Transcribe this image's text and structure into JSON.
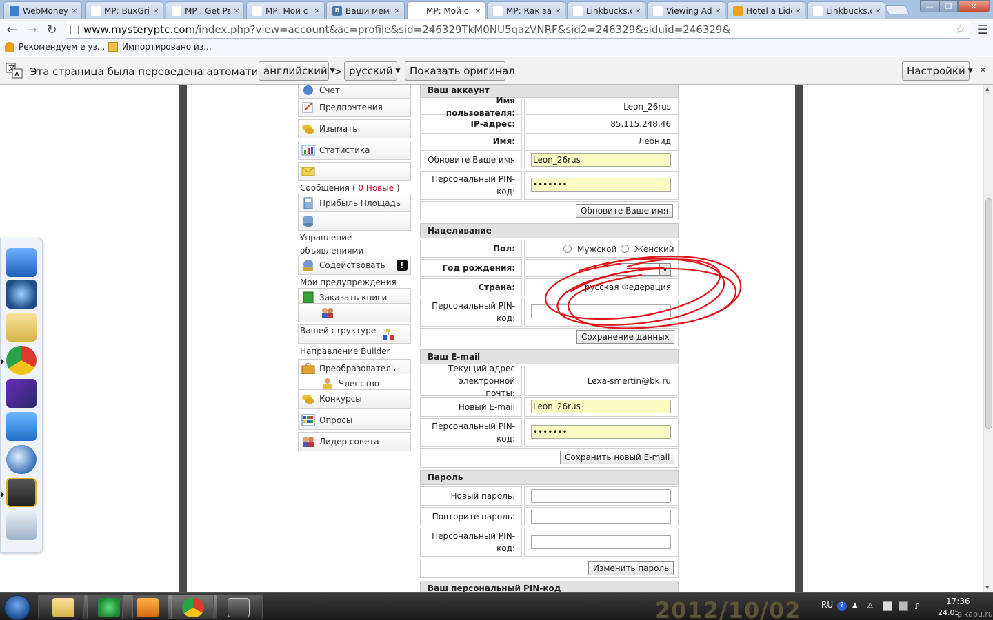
{
  "tabs": [
    {
      "label": "WebMoney",
      "favicon_color": "#3d7fd0",
      "favicon_text": ""
    },
    {
      "label": "MP: BuxGri",
      "favicon_color": "#ffffff",
      "favicon_text": ""
    },
    {
      "label": "MP : Get Pa",
      "favicon_color": "#ffffff",
      "favicon_text": ""
    },
    {
      "label": "MP: Мой с",
      "favicon_color": "#ffffff",
      "favicon_text": ""
    },
    {
      "label": "Ваши мем",
      "favicon_color": "#4a76a8",
      "favicon_text": "B"
    },
    {
      "label": "MP: Мой с",
      "favicon_color": "#ffffff",
      "favicon_text": ""
    },
    {
      "label": "MP: Как зар",
      "favicon_color": "#ffffff",
      "favicon_text": ""
    },
    {
      "label": "Linkbucks.c",
      "favicon_color": "#ffffff",
      "favicon_text": ""
    },
    {
      "label": "Viewing Ad",
      "favicon_color": "#ffffff",
      "favicon_text": ""
    },
    {
      "label": "Hotel a Lido",
      "favicon_color": "#e9a21a",
      "favicon_text": ""
    },
    {
      "label": "Linkbucks.c",
      "favicon_color": "#ffffff",
      "favicon_text": ""
    }
  ],
  "active_tab": 5,
  "toolbar": {
    "back_icon": "back-arrow-icon",
    "forward_icon": "forward-arrow-icon",
    "reload_icon": "reload-icon",
    "url_host": "www.mysteryptc.com",
    "url_path": "/index.php?view=account&ac=profile&sid=246329TkM0NU5qazVNRF&sid2=246329&siduid=246329&"
  },
  "bookmarks": [
    {
      "label": "Рекомендуем",
      "label_tail": "е уз..."
    },
    {
      "label": "Импортировано из..."
    }
  ],
  "translate_bar": {
    "message": "Эта страница была переведена автоматически",
    "from_lang": "английский",
    "arrow": ">",
    "to_lang": "русский",
    "show_original": "Показать оригинал",
    "settings": "Настройки"
  },
  "menu": {
    "items": [
      {
        "label": "Счет",
        "icon": "account-icon"
      },
      {
        "label": "Предпочтения",
        "icon": "pencil-note-icon"
      },
      {
        "label": "Изымать",
        "icon": "coins-icon"
      },
      {
        "label": "Статистика",
        "icon": "bar-chart-icon"
      },
      {
        "label": "",
        "icon": "envelope-icon"
      },
      {
        "label": "Прибыль Площадь",
        "icon": "calculator-icon"
      },
      {
        "label": "",
        "icon": "database-icon"
      },
      {
        "label": "Содействовать",
        "icon": "promote-icon"
      },
      {
        "label": "Заказать книги",
        "icon": "book-icon"
      },
      {
        "label": "",
        "icon": "users-icon"
      },
      {
        "label": "Вашей структуре",
        "icon": "structure-icon"
      },
      {
        "label": "Преобразователь",
        "icon": "briefcase-icon"
      },
      {
        "label": "Членство",
        "icon": "member-icon"
      },
      {
        "label": "Конкурсы",
        "icon": "coins-icon"
      },
      {
        "label": "Опросы",
        "icon": "grid-icon"
      },
      {
        "label": "Лидер совета",
        "icon": "users-icon"
      }
    ],
    "captions": {
      "messages_prefix": "Сообщения (",
      "messages_new": "0 Новые",
      "messages_suffix": ")",
      "ads_manage": "Управление объявлениями",
      "my_alerts": "Мои предупреждения",
      "builder": "Направление Builder"
    }
  },
  "account": {
    "section_title": "Ваш аккаунт",
    "username_label": "Имя пользователя:",
    "username_value": "Leon_26rus",
    "ip_label": "IP-адрес:",
    "ip_value": "85.115.248.46",
    "name_label": "Имя:",
    "name_value": "Леонид",
    "update_name_label": "Обновите Ваше имя",
    "update_name_value": "Leon_26rus",
    "pin_label": "Персональный PIN-код:",
    "pin_value": "•••••••",
    "update_button": "Обновите Ваше имя"
  },
  "targeting": {
    "section_title": "Нацеливание",
    "gender_label": "Пол:",
    "male": "Мужской",
    "female": "Женский",
    "birth_label": "Год рождения:",
    "country_label": "Страна:",
    "country_value": "русская Федерация",
    "pin_label": "Персональный PIN-код:",
    "save_button": "Сохранение данных"
  },
  "email": {
    "section_title": "Ваш E-mail",
    "current_label": "Текущий адрес электронной почты:",
    "current_value": "Lexa-smertin@bk.ru",
    "new_label": "Новый E-mail",
    "new_value": "Leon_26rus",
    "pin_label": "Персональный PIN-код:",
    "pin_value": "•••••••",
    "save_button": "Сохранить новый E-mail"
  },
  "password": {
    "section_title": "Пароль",
    "new_label": "Новый пароль:",
    "repeat_label": "Повторите пароль:",
    "pin_label": "Персональный PIN-код:",
    "change_button": "Изменить пароль"
  },
  "pin_section": {
    "section_title": "Ваш персональный PIN-код"
  },
  "annotation": {
    "stroke_color": "#e0141a"
  },
  "taskbar": {
    "wallpaper_text": "2012/10/02",
    "lang": "RU",
    "time": "17:36",
    "date": "24.05.",
    "watermark": "pikabu.ru"
  }
}
